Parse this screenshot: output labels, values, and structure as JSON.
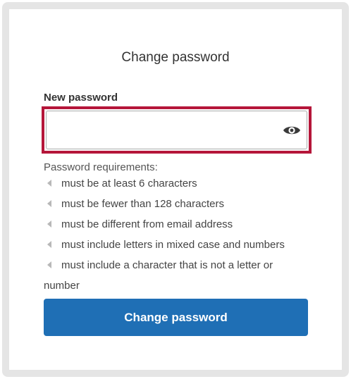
{
  "form": {
    "title": "Change password",
    "new_password_label": "New password",
    "new_password_value": "",
    "show_password_icon": "eye-icon",
    "requirements_heading": "Password requirements:",
    "requirements": [
      "must be at least 6 characters",
      "must be fewer than 128 characters",
      "must be different from email address",
      "must include letters in mixed case and numbers",
      "must include a character that is not a letter or number"
    ],
    "submit_label": "Change password"
  },
  "colors": {
    "frame_background": "#e5e5e5",
    "focus_outline": "#b5163a",
    "button_background": "#1f6fb5",
    "button_text": "#ffffff",
    "requirement_marker": "#b8b8b8"
  }
}
